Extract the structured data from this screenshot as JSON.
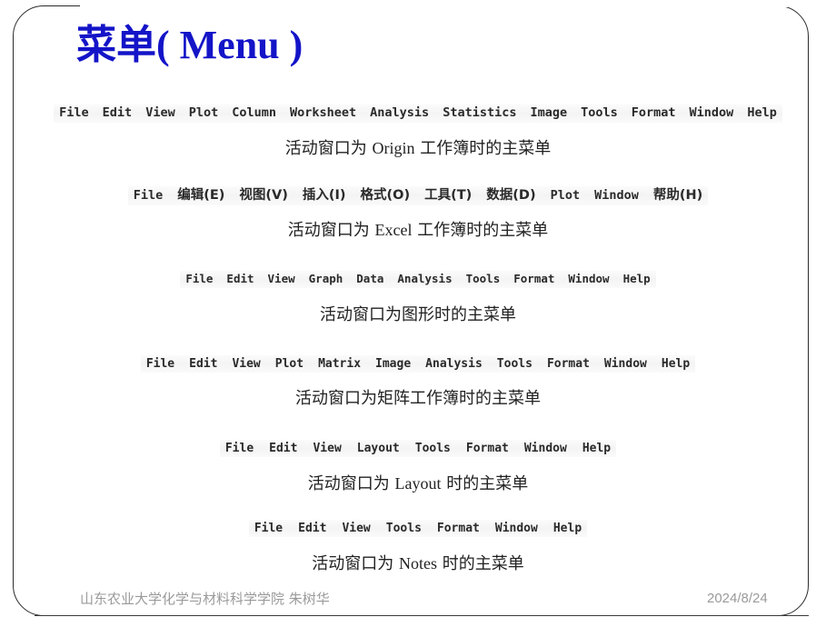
{
  "slide": {
    "title_cjk": "菜单",
    "title_latin": "( Menu )",
    "title_color": "#1414c8"
  },
  "menus": [
    {
      "id": "origin-workbook",
      "items": [
        "File",
        "Edit",
        "View",
        "Plot",
        "Column",
        "Worksheet",
        "Analysis",
        "Statistics",
        "Image",
        "Tools",
        "Format",
        "Window",
        "Help"
      ],
      "caption": "活动窗口为 Origin 工作簿时的主菜单"
    },
    {
      "id": "excel-workbook",
      "items": [
        "File",
        "编辑(E)",
        "视图(V)",
        "插入(I)",
        "格式(O)",
        "工具(T)",
        "数据(D)",
        "Plot",
        "Window",
        "帮助(H)"
      ],
      "caption": "活动窗口为 Excel 工作簿时的主菜单"
    },
    {
      "id": "graph",
      "items": [
        "File",
        "Edit",
        "View",
        "Graph",
        "Data",
        "Analysis",
        "Tools",
        "Format",
        "Window",
        "Help"
      ],
      "caption": "活动窗口为图形时的主菜单"
    },
    {
      "id": "matrix-workbook",
      "items": [
        "File",
        "Edit",
        "View",
        "Plot",
        "Matrix",
        "Image",
        "Analysis",
        "Tools",
        "Format",
        "Window",
        "Help"
      ],
      "caption": "活动窗口为矩阵工作簿时的主菜单"
    },
    {
      "id": "layout",
      "items": [
        "File",
        "Edit",
        "View",
        "Layout",
        "Tools",
        "Format",
        "Window",
        "Help"
      ],
      "caption": "活动窗口为 Layout 时的主菜单"
    },
    {
      "id": "notes",
      "items": [
        "File",
        "Edit",
        "View",
        "Tools",
        "Format",
        "Window",
        "Help"
      ],
      "caption": "活动窗口为 Notes 时的主菜单"
    }
  ],
  "footer": {
    "left": "山东农业大学化学与材料科学学院  朱树华",
    "right": "2024/8/24"
  }
}
